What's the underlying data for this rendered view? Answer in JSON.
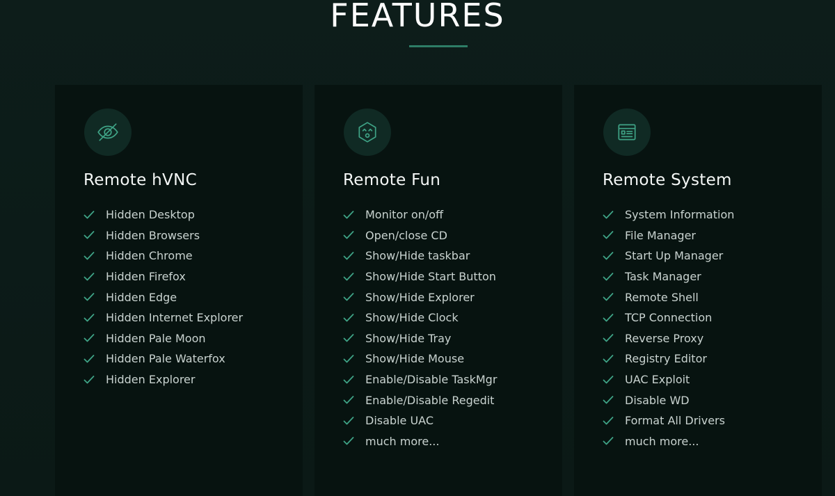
{
  "page": {
    "title": "FEATURES"
  },
  "colors": {
    "background": "#0b1a17",
    "card": "#071310",
    "accent": "#2e7d66",
    "icon_bg": "#102a24"
  },
  "cards": [
    {
      "icon": "eye-slash-icon",
      "title": "Remote hVNC",
      "items": [
        "Hidden Desktop",
        "Hidden Browsers",
        "Hidden Chrome",
        "Hidden Firefox",
        "Hidden Edge",
        "Hidden Internet Explorer",
        "Hidden Pale Moon",
        "Hidden Pale Waterfox",
        "Hidden Explorer"
      ]
    },
    {
      "icon": "fun-face-icon",
      "title": "Remote Fun",
      "items": [
        "Monitor on/off",
        "Open/close CD",
        "Show/Hide taskbar",
        "Show/Hide Start Button",
        "Show/Hide Explorer",
        "Show/Hide Clock",
        "Show/Hide Tray",
        "Show/Hide Mouse",
        "Enable/Disable TaskMgr",
        "Enable/Disable Regedit",
        "Disable UAC",
        "much more..."
      ]
    },
    {
      "icon": "system-window-icon",
      "title": "Remote System",
      "items": [
        "System Information",
        "File Manager",
        "Start Up Manager",
        "Task Manager",
        "Remote Shell",
        "TCP Connection",
        "Reverse Proxy",
        "Registry Editor",
        "UAC Exploit",
        "Disable WD",
        "Format All Drivers",
        "much more..."
      ]
    }
  ]
}
